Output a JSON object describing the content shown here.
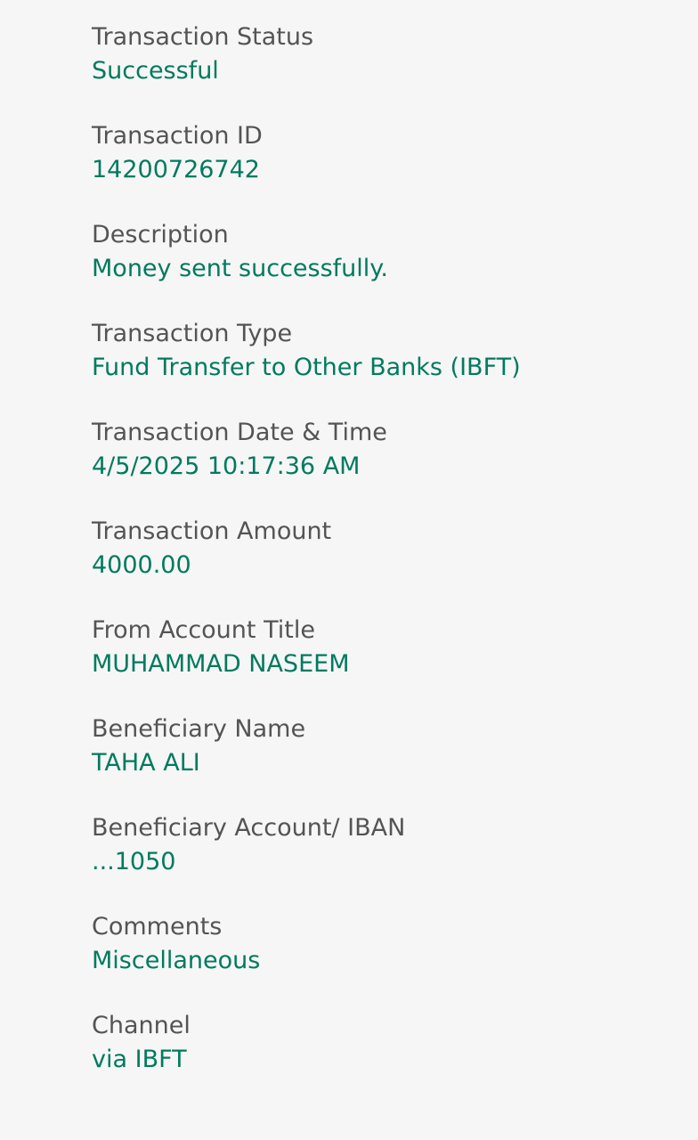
{
  "colors": {
    "background": "#f6f6f6",
    "label": "#545454",
    "value": "#007a5e"
  },
  "fields": [
    {
      "label": "Transaction Status",
      "value": "Successful"
    },
    {
      "label": "Transaction ID",
      "value": "14200726742"
    },
    {
      "label": "Description",
      "value": "Money sent successfully."
    },
    {
      "label": "Transaction Type",
      "value": "Fund Transfer to Other Banks (IBFT)"
    },
    {
      "label": "Transaction Date & Time",
      "value": "4/5/2025 10:17:36 AM"
    },
    {
      "label": "Transaction Amount",
      "value": "4000.00"
    },
    {
      "label": "From Account Title",
      "value": "MUHAMMAD NASEEM"
    },
    {
      "label": "Beneficiary Name",
      "value": "TAHA ALI"
    },
    {
      "label": "Beneficiary Account/ IBAN",
      "value": "...1050"
    },
    {
      "label": "Comments",
      "value": "Miscellaneous"
    },
    {
      "label": "Channel",
      "value": "via IBFT"
    }
  ]
}
